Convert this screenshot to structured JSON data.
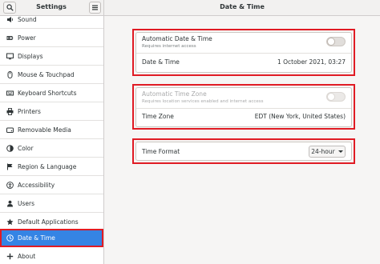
{
  "window": {
    "app_title": "Settings",
    "page_title": "Date & Time"
  },
  "sidebar": {
    "items": [
      {
        "label": "Sound",
        "icon": "speaker-icon"
      },
      {
        "label": "Power",
        "icon": "power-icon"
      },
      {
        "label": "Displays",
        "icon": "display-icon"
      },
      {
        "label": "Mouse & Touchpad",
        "icon": "mouse-icon"
      },
      {
        "label": "Keyboard Shortcuts",
        "icon": "keyboard-icon"
      },
      {
        "label": "Printers",
        "icon": "printer-icon"
      },
      {
        "label": "Removable Media",
        "icon": "media-icon"
      },
      {
        "label": "Color",
        "icon": "color-icon"
      },
      {
        "label": "Region & Language",
        "icon": "flag-icon"
      },
      {
        "label": "Accessibility",
        "icon": "accessibility-icon"
      },
      {
        "label": "Users",
        "icon": "users-icon"
      },
      {
        "label": "Default Applications",
        "icon": "star-icon"
      },
      {
        "label": "Date & Time",
        "icon": "clock-icon",
        "selected": true
      },
      {
        "label": "About",
        "icon": "plus-icon"
      }
    ]
  },
  "auto_datetime": {
    "title": "Automatic Date & Time",
    "subtitle": "Requires internet access",
    "enabled": false
  },
  "date_time": {
    "label": "Date & Time",
    "value": "1 October 2021, 03:27"
  },
  "auto_timezone": {
    "title": "Automatic Time Zone",
    "subtitle": "Requires location services enabled and internet access",
    "enabled": false,
    "disabled": true
  },
  "timezone": {
    "label": "Time Zone",
    "value": "EDT (New York, United States)"
  },
  "time_format": {
    "label": "Time Format",
    "selected": "24-hour"
  },
  "colors": {
    "accent": "#3584e4",
    "highlight": "#e01b24"
  }
}
